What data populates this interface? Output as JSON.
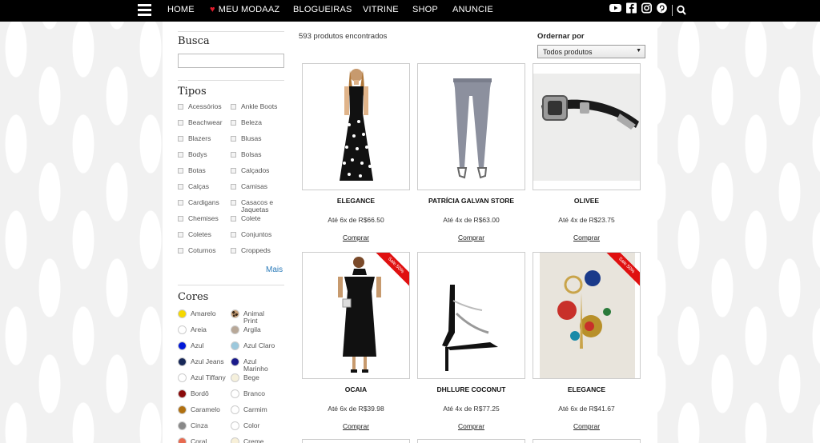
{
  "nav": {
    "items": [
      "HOME",
      "MEU MODAAZ",
      "BLOGUEIRAS",
      "VITRINE",
      "SHOP",
      "ANUNCIE"
    ],
    "social": [
      "youtube-icon",
      "facebook-icon",
      "instagram-icon",
      "pinterest-icon",
      "search-icon"
    ]
  },
  "sidebar": {
    "busca_title": "Busca",
    "search_value": "",
    "tipos_title": "Tipos",
    "tipos": [
      "Acessórios",
      "Ankle Boots",
      "Beachwear",
      "Beleza",
      "Blazers",
      "Blusas",
      "Bodys",
      "Bolsas",
      "Botas",
      "Calçados",
      "Calças",
      "Camisas",
      "Cardigans",
      "Casacos e Jaquetas",
      "Chemises",
      "Colete",
      "Coletes",
      "Conjuntos",
      "Coturnos",
      "Croppeds"
    ],
    "mais": "Mais",
    "cores_title": "Cores",
    "cores": [
      {
        "name": "Amarelo",
        "color": "#f5d800"
      },
      {
        "name": "Animal Print",
        "color": "#8a6a4a"
      },
      {
        "name": "Areia",
        "color": "#ffffff"
      },
      {
        "name": "Argila",
        "color": "#b8a898"
      },
      {
        "name": "Azul",
        "color": "#0018d8"
      },
      {
        "name": "Azul Claro",
        "color": "#9cc8dc"
      },
      {
        "name": "Azul Jeans",
        "color": "#182858"
      },
      {
        "name": "Azul Marinho",
        "color": "#1a1a8a"
      },
      {
        "name": "Azul Tiffany",
        "color": "#ffffff"
      },
      {
        "name": "Bege",
        "color": "#f5f0dc"
      },
      {
        "name": "Bordô",
        "color": "#8a0a0a"
      },
      {
        "name": "Branco",
        "color": "#ffffff"
      },
      {
        "name": "Caramelo",
        "color": "#b07010"
      },
      {
        "name": "Carmim",
        "color": "#ffffff"
      },
      {
        "name": "Cinza",
        "color": "#888888"
      },
      {
        "name": "Color",
        "color": "#ffffff"
      },
      {
        "name": "Coral",
        "color": "#e86a50"
      },
      {
        "name": "Creme",
        "color": "#f8f0d8"
      }
    ]
  },
  "results": {
    "count_text": "593 produtos encontrados",
    "sort_label": "Ordernar por",
    "sort_value": "Todos produtos"
  },
  "products": [
    {
      "brand": "ELEGANCE",
      "price": "Até 6x de R$66.50",
      "buy": "Comprar",
      "sale": ""
    },
    {
      "brand": "PATRÍCIA GALVAN STORE",
      "price": "Até 4x de R$63.00",
      "buy": "Comprar",
      "sale": ""
    },
    {
      "brand": "OLIVEE",
      "price": "Até 4x de R$23.75",
      "buy": "Comprar",
      "sale": ""
    },
    {
      "brand": "OCAIA",
      "price": "Até 6x de R$39.98",
      "buy": "Comprar",
      "sale": "Sale 50%"
    },
    {
      "brand": "DHLLURE COCONUT",
      "price": "Até 4x de R$77.25",
      "buy": "Comprar",
      "sale": ""
    },
    {
      "brand": "ELEGANCE",
      "price": "Até 6x de R$41.67",
      "buy": "Comprar",
      "sale": "Sale 50%"
    }
  ]
}
